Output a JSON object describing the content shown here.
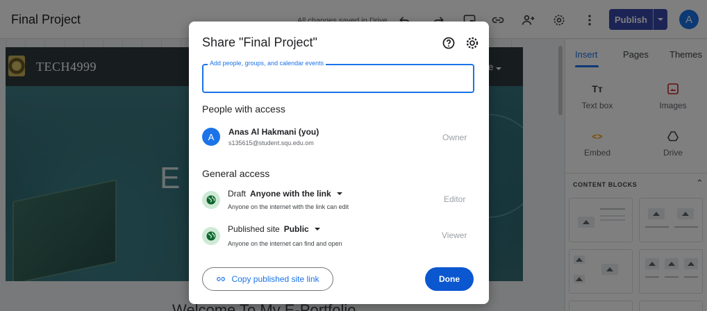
{
  "topbar": {
    "title": "Final Project",
    "saved_status": "All changes saved in Drive",
    "publish_label": "Publish",
    "avatar_initial": "A",
    "icons": [
      "undo-icon",
      "redo-icon",
      "preview-icon",
      "link-icon",
      "share-person-icon",
      "settings-icon",
      "more-icon"
    ]
  },
  "site": {
    "name": "TECH4999",
    "nav_more": "re",
    "hero_letter": "E",
    "welcome_text": "Welcome To My E-Portfolio"
  },
  "right_panel": {
    "tabs": [
      {
        "label": "Insert",
        "active": true
      },
      {
        "label": "Pages",
        "active": false
      },
      {
        "label": "Themes",
        "active": false
      }
    ],
    "tools": [
      {
        "label": "Text box",
        "icon": "text-box-icon"
      },
      {
        "label": "Images",
        "icon": "image-icon"
      },
      {
        "label": "Embed",
        "icon": "embed-icon"
      },
      {
        "label": "Drive",
        "icon": "drive-icon"
      }
    ],
    "content_blocks_heading": "CONTENT BLOCKS"
  },
  "dialog": {
    "title": "Share \"Final Project\"",
    "share_field_label": "Add people, groups, and calendar events",
    "people_heading": "People with access",
    "owner": {
      "initial": "A",
      "name": "Anas Al Hakmani (you)",
      "email": "s135615@student.squ.edu.om",
      "role": "Owner"
    },
    "general_heading": "General access",
    "draft": {
      "label": "Draft",
      "selection": "Anyone with the link",
      "description": "Anyone on the internet with the link can edit",
      "role": "Editor"
    },
    "published": {
      "label": "Published site",
      "selection": "Public",
      "description": "Anyone on the internet can find and open",
      "role": "Viewer"
    },
    "copy_link_label": "Copy published site link",
    "done_label": "Done"
  },
  "colors": {
    "accent": "#1a73e8",
    "publish": "#3949ab",
    "done": "#0b57d0",
    "globe_bg": "#ceead6"
  }
}
